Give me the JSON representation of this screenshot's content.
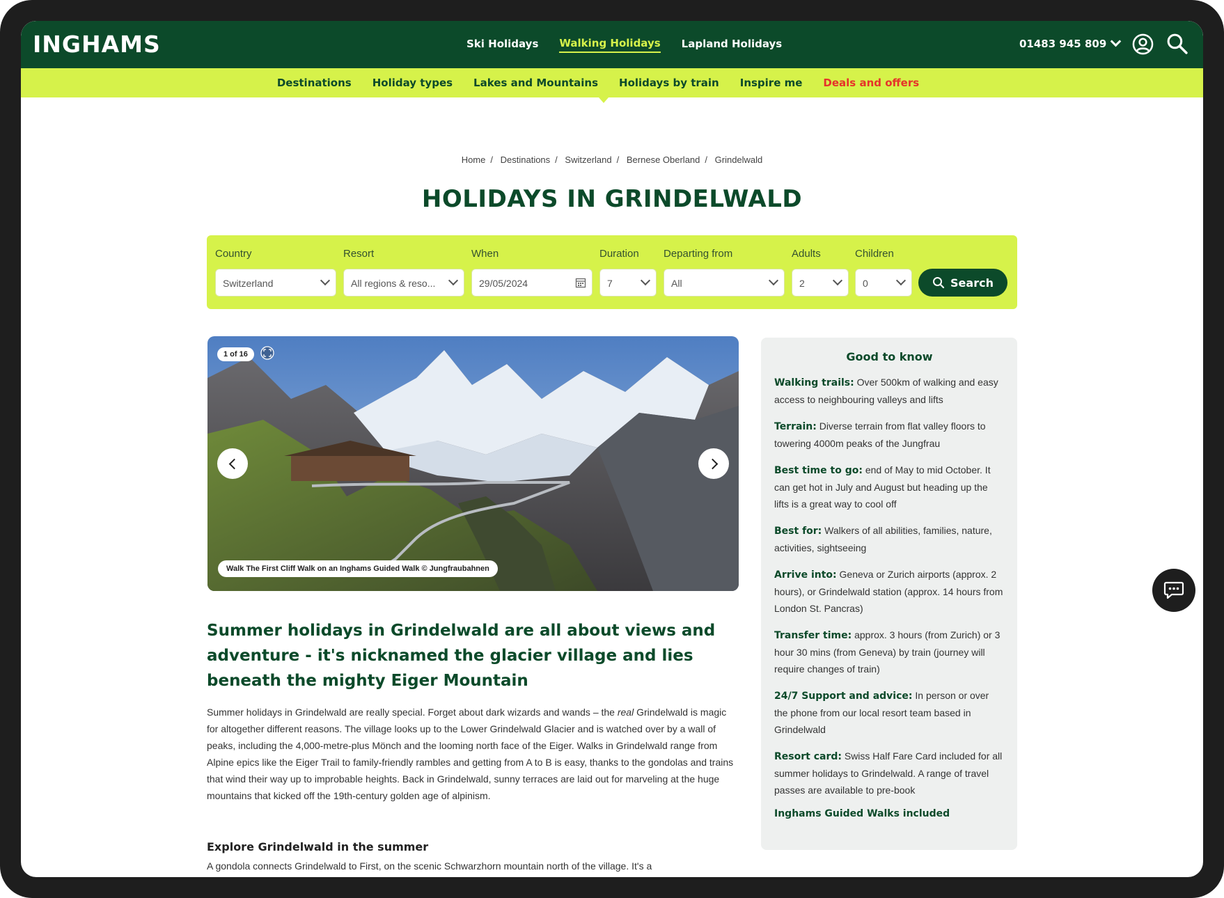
{
  "header": {
    "logo": "INGHAMS",
    "main_nav": [
      "Ski Holidays",
      "Walking Holidays",
      "Lapland Holidays"
    ],
    "active_main": "Walking Holidays",
    "phone": "01483 945 809",
    "sub_nav": [
      "Destinations",
      "Holiday types",
      "Lakes and Mountains",
      "Holidays by train",
      "Inspire me",
      "Deals and offers"
    ],
    "deal_color": "#e6332a",
    "brand_green": "#0c4a2a",
    "brand_lime": "#d6f24a"
  },
  "breadcrumb": [
    "Home",
    "Destinations",
    "Switzerland",
    "Bernese Oberland",
    "Grindelwald"
  ],
  "page_title": "HOLIDAYS IN GRINDELWALD",
  "search": {
    "country": {
      "label": "Country",
      "value": "Switzerland"
    },
    "resort": {
      "label": "Resort",
      "value": "All regions & reso..."
    },
    "when": {
      "label": "When",
      "value": "29/05/2024"
    },
    "duration": {
      "label": "Duration",
      "value": "7"
    },
    "departing": {
      "label": "Departing from",
      "value": "All"
    },
    "adults": {
      "label": "Adults",
      "value": "2"
    },
    "children": {
      "label": "Children",
      "value": "0"
    },
    "button": "Search"
  },
  "gallery": {
    "counter": "1 of 16",
    "caption": "Walk The First Cliff Walk on an Inghams Guided Walk © Jungfraubahnen"
  },
  "article": {
    "lead": "Summer holidays in Grindelwald are all about views and adventure - it's nicknamed the glacier village and lies beneath the mighty Eiger Mountain",
    "p1_a": "Summer holidays in Grindelwald are really special. Forget about dark wizards and wands – the ",
    "p1_em": "real",
    "p1_b": " Grindelwald is magic for altogether different reasons. The village looks up to the Lower Grindelwald Glacier and is watched over by a wall of peaks, including the 4,000-metre-plus Mönch and the looming north face of the Eiger. Walks in Grindelwald range from Alpine epics like the Eiger Trail to family-friendly rambles and getting from A to B is easy, thanks to the gondolas and trains that wind their way up to improbable heights. Back in Grindelwald, sunny terraces are laid out for marveling at the huge mountains that kicked off the 19th-century golden age of alpinism.",
    "h3": "Explore Grindelwald in the summer",
    "p2": "A gondola connects Grindelwald to First, on the scenic Schwarzhorn mountain north of the village. It's a"
  },
  "good_to_know": {
    "title": "Good to know",
    "items": [
      {
        "label": "Walking trails:",
        "text": " Over 500km of walking and easy access to neighbouring valleys and lifts"
      },
      {
        "label": "Terrain:",
        "text": " Diverse terrain from flat valley floors to towering 4000m peaks of the Jungfrau"
      },
      {
        "label": "Best time to go:",
        "text": " end of May to mid October. It can get hot in July and August but heading up the lifts is a great way to cool off"
      },
      {
        "label": "Best for:",
        "text": " Walkers of all abilities, families, nature, activities, sightseeing"
      },
      {
        "label": "Arrive into:",
        "text": " Geneva or Zurich airports (approx. 2 hours), or Grindelwald station (approx. 14 hours from London St. Pancras)"
      },
      {
        "label": "Transfer time:",
        "text": " approx. 3 hours (from Zurich) or 3 hour 30 mins (from Geneva) by train (journey will require changes of train)"
      },
      {
        "label": "24/7 Support and advice:",
        "text": " In person or over the phone from our local resort team based in Grindelwald"
      },
      {
        "label": "Resort card:",
        "text": " Swiss Half Fare Card included for all summer holidays to Grindelwald. A range of travel passes are available to pre-book"
      }
    ],
    "footer": "Inghams Guided Walks included"
  }
}
